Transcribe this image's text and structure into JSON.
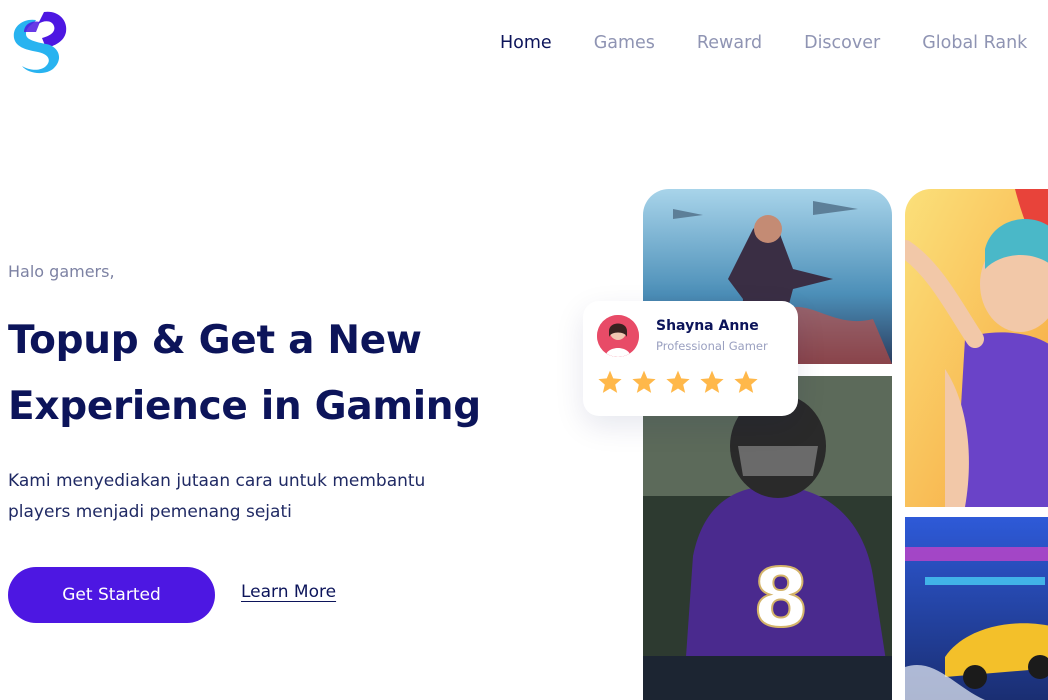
{
  "nav": {
    "items": [
      "Home",
      "Games",
      "Reward",
      "Discover",
      "Global Rank"
    ],
    "active": "Home"
  },
  "hero": {
    "greeting": "Halo gamers,",
    "headline_part1": "Topup & Get a",
    "headline_highlight1": "New",
    "headline_highlight2": "Experience",
    "headline_part2": "in Gaming",
    "description_line1": "Kami menyediakan jutaan cara untuk membantu",
    "description_line2": "players menjadi pemenang sejati",
    "cta_primary": "Get Started",
    "cta_secondary": "Learn More"
  },
  "review_card": {
    "name": "Shayna Anne",
    "role": "Professional Gamer",
    "rating": 5
  },
  "colors": {
    "primary": "#4d17e2",
    "navy": "#0c145a",
    "highlight": "#41c3f2",
    "star": "#ffb84a",
    "muted": "#8f94b3"
  },
  "icons": [
    "logo-s-icon",
    "star-icon"
  ]
}
